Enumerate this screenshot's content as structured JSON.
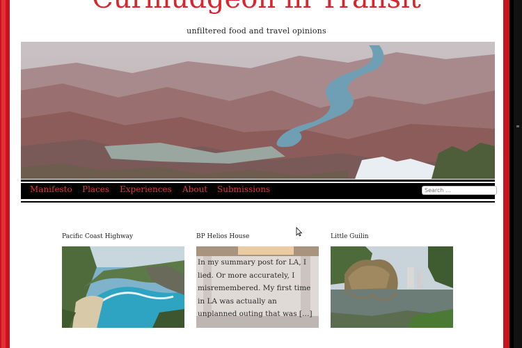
{
  "site": {
    "title": "Curmudgeon in Transit",
    "tagline": "unfiltered food and travel opinions"
  },
  "nav": {
    "items": [
      "Manifesto",
      "Places",
      "Experiences",
      "About",
      "Submissions"
    ],
    "search_placeholder": "Search ..."
  },
  "posts": [
    {
      "title": "Pacific Coast Highway",
      "image": "coastal cove with turquoise water"
    },
    {
      "title": "BP Helios House",
      "image": "gas station canopy interior",
      "excerpt": "In my summary post for LA, I lied. Or more accurately, I misremembered. My first time in LA was actually an unplanned outing that was […]"
    },
    {
      "title": "Little Guilin",
      "image": "rock hills reflected in lake"
    }
  ],
  "colors": {
    "brand_red": "#d9252d",
    "nav_background": "#000000",
    "page_background": "#ffffff"
  },
  "icons": [
    "mouse-pointer-icon"
  ]
}
